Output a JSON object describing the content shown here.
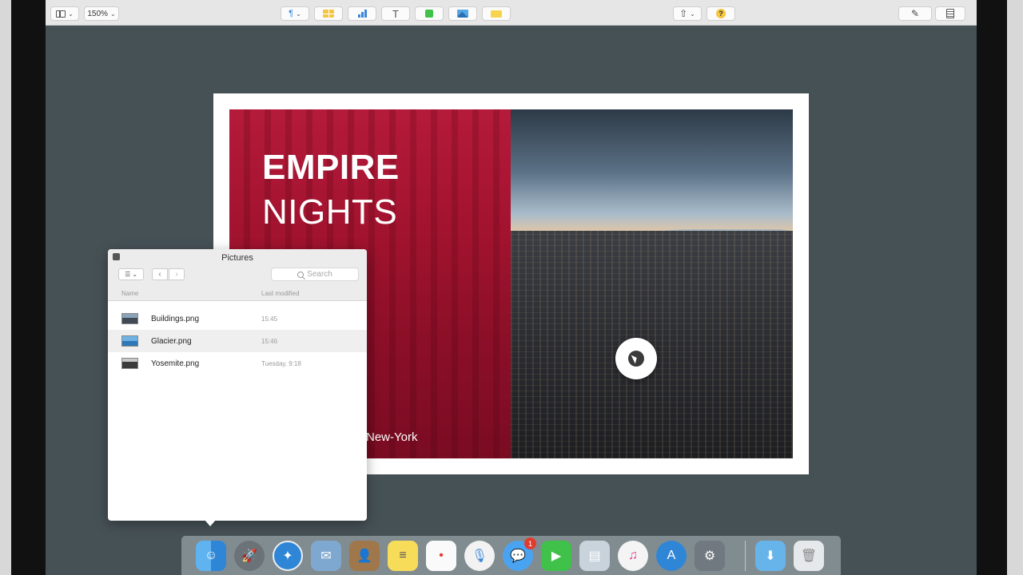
{
  "toolbar": {
    "zoom": "150%"
  },
  "slide": {
    "title_bold": "EMPIRE",
    "title_light": "NIGHTS",
    "subtitle": "New-York"
  },
  "picker": {
    "title": "Pictures",
    "search_placeholder": "Search",
    "columns": {
      "name": "Name",
      "modified": "Last modified"
    },
    "files": [
      {
        "name": "Buildings.png",
        "modified": "15:45"
      },
      {
        "name": "Glacier.png",
        "modified": "15:46"
      },
      {
        "name": "Yosemite.png",
        "modified": "Tuesday, 9:18"
      }
    ]
  },
  "dock": {
    "messages_badge": "1",
    "apps": [
      "finder-icon",
      "launchpad-icon",
      "safari-icon",
      "mail-icon",
      "contacts-icon",
      "notes-icon",
      "reminders-icon",
      "siri-icon",
      "messages-icon",
      "facetime-icon",
      "photos-icon",
      "itunes-icon",
      "app-store-icon",
      "system-preferences-icon",
      "downloads-folder-icon",
      "trash-icon"
    ]
  },
  "colors": {
    "slide_red": "#a2132f",
    "background": "#465156",
    "toolbar": "#e6e6e6"
  }
}
